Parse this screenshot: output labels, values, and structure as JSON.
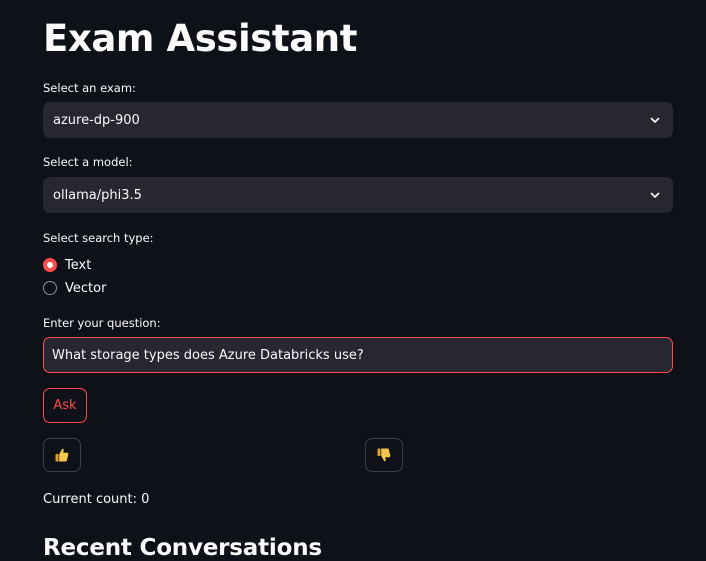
{
  "app": {
    "title": "Exam Assistant"
  },
  "exam_select": {
    "label": "Select an exam:",
    "value": "azure-dp-900"
  },
  "model_select": {
    "label": "Select a model:",
    "value": "ollama/phi3.5"
  },
  "search_type": {
    "label": "Select search type:",
    "options": [
      {
        "label": "Text",
        "selected": true
      },
      {
        "label": "Vector",
        "selected": false
      }
    ]
  },
  "question": {
    "label": "Enter your question:",
    "value": "What storage types does Azure Databricks use?"
  },
  "ask_button": {
    "label": "Ask"
  },
  "feedback": {
    "thumbs_up_icon": "thumbs-up-icon",
    "thumbs_down_icon": "thumbs-down-icon"
  },
  "count": {
    "text": "Current count: 0"
  },
  "recent": {
    "heading": "Recent Conversations"
  },
  "colors": {
    "background": "#0e1117",
    "widget": "#262730",
    "accent": "#ff4b4b",
    "text": "#fafafa",
    "thumb": "#f5c84c"
  }
}
